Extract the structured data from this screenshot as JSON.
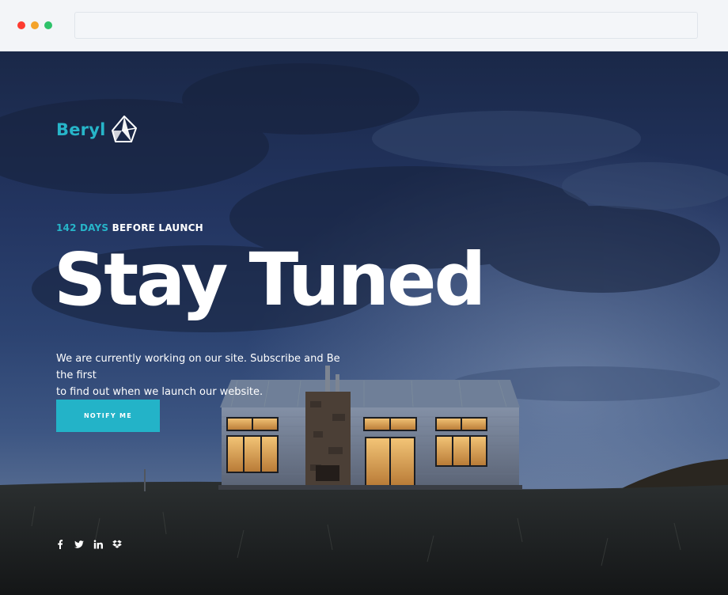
{
  "browser": {
    "address": ""
  },
  "brand": {
    "name": "Beryl",
    "accent_color": "#27b5c9",
    "logo_icon": "gem-icon"
  },
  "hero": {
    "countdown_days": "142 DAYS",
    "countdown_suffix": "BEFORE LAUNCH",
    "headline": "Stay Tuned",
    "intro_line1": "We are currently working on our site. Subscribe and Be the first",
    "intro_line2": "to find out when we launch our website.",
    "button_label": "NOTIFY ME"
  },
  "social": [
    {
      "name": "facebook",
      "icon": "facebook-icon"
    },
    {
      "name": "twitter",
      "icon": "twitter-icon"
    },
    {
      "name": "linkedin",
      "icon": "linkedin-icon"
    },
    {
      "name": "dropbox",
      "icon": "dropbox-icon"
    }
  ]
}
